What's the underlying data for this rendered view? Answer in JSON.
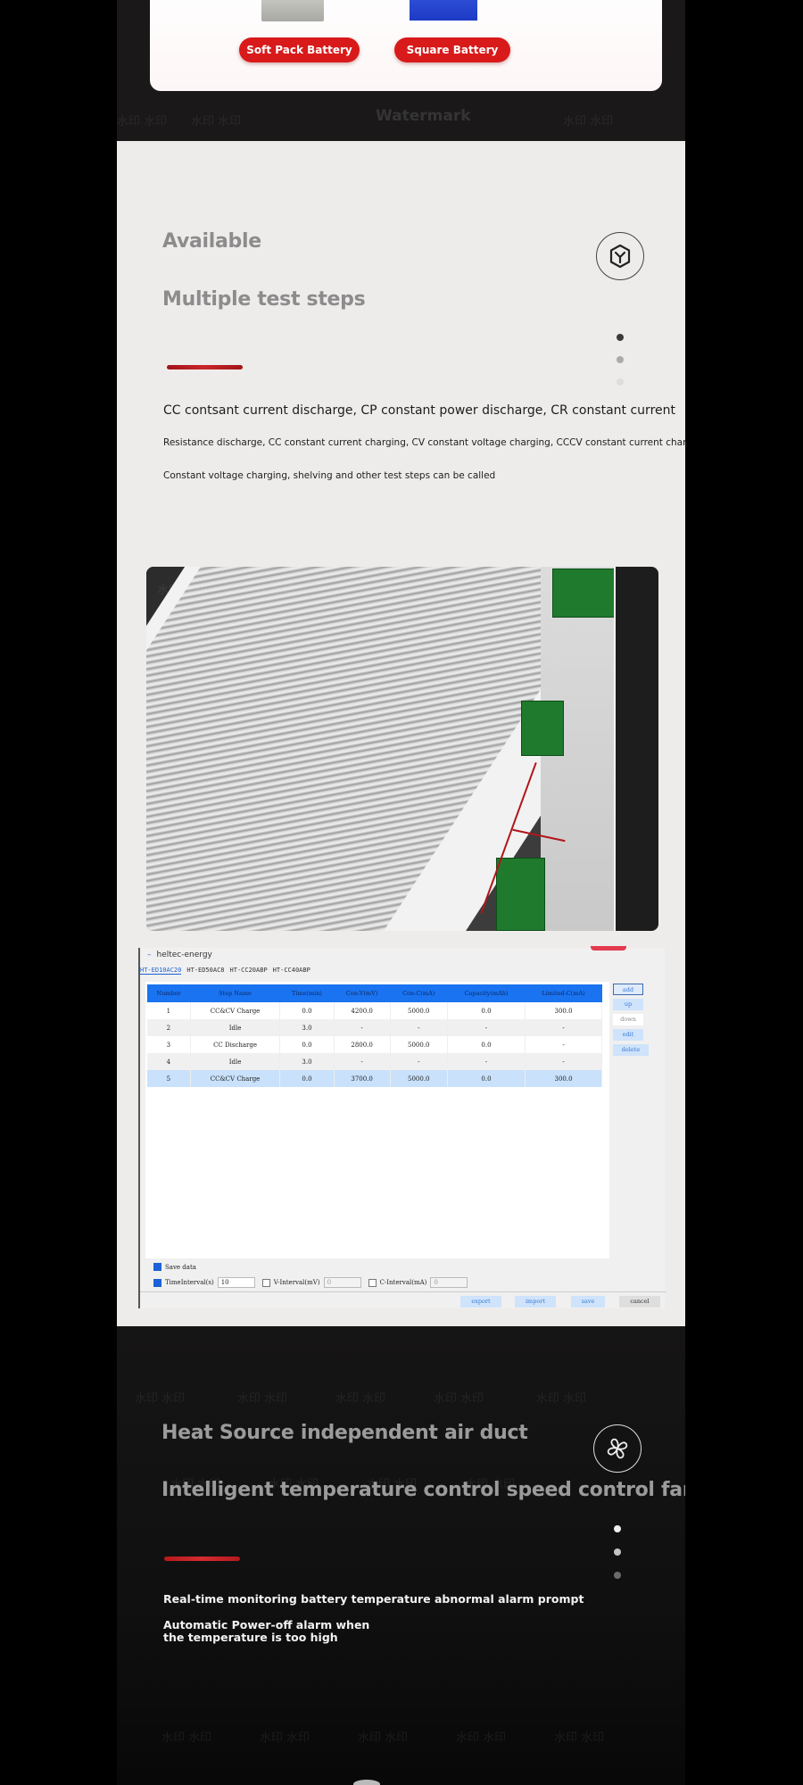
{
  "battery_card": {
    "buttons": [
      {
        "label": "Soft Pack Battery"
      },
      {
        "label": "Square Battery"
      }
    ],
    "watermark_label": "Watermark",
    "watermark_repeat": "水印 水印"
  },
  "test_steps_section": {
    "heading_line1": "Available",
    "heading_line2": "Multiple test steps",
    "icon": "cube-icon",
    "description_lines": [
      "CC contsant current discharge, CP constant power discharge, CR constant current",
      "Resistance discharge, CC constant current charging, CV constant voltage charging, CCCV constant current charging",
      "Constant voltage charging, shelving and other test steps can be called"
    ],
    "pagination": {
      "total": 3,
      "active": 1
    }
  },
  "software_window": {
    "title": "heltec-energy",
    "tabs": [
      {
        "label": "HT-ED10AC20",
        "active": true
      },
      {
        "label": "HT-ED50AC8",
        "active": false
      },
      {
        "label": "HT-CC20ABP",
        "active": false
      },
      {
        "label": "HT-CC40ABP",
        "active": false
      }
    ],
    "table": {
      "columns": [
        "Number",
        "Step Name",
        "Time(min)",
        "Con-V(mV)",
        "Con-C(mA)",
        "Capacity(mAh)",
        "Limited-C(mA)"
      ],
      "rows": [
        [
          "1",
          "CC&CV Charge",
          "0.0",
          "4200.0",
          "5000.0",
          "0.0",
          "300.0"
        ],
        [
          "2",
          "Idle",
          "3.0",
          "-",
          "-",
          "-",
          "-"
        ],
        [
          "3",
          "CC Discharge",
          "0.0",
          "2800.0",
          "5000.0",
          "0.0",
          "-"
        ],
        [
          "4",
          "Idle",
          "3.0",
          "-",
          "-",
          "-",
          "-"
        ],
        [
          "5",
          "CC&CV Charge",
          "0.0",
          "3700.0",
          "5000.0",
          "0.0",
          "300.0"
        ]
      ],
      "selected_row": 5
    },
    "side_buttons": [
      "add",
      "up",
      "down",
      "edit",
      "delete"
    ],
    "options": {
      "save_data_label": "Save data",
      "save_data_checked": true,
      "time_interval_label": "TimeInterval(s)",
      "time_interval_checked": true,
      "time_interval_value": "10",
      "v_interval_label": "V-Interval(mV)",
      "v_interval_checked": false,
      "v_interval_value": "0",
      "c_interval_label": "C-Interval(mA)",
      "c_interval_checked": false,
      "c_interval_value": "0"
    },
    "bottom_buttons": [
      "export",
      "import",
      "save",
      "cancel"
    ]
  },
  "fan_section": {
    "heading_line1": "Heat Source independent air duct",
    "heading_line2": "Intelligent temperature control speed control fan",
    "icon": "fan-icon",
    "bullets": [
      "Real-time monitoring battery temperature abnormal alarm prompt",
      "Automatic Power-off alarm when the temperature is too high"
    ],
    "pagination": {
      "total": 3,
      "active": 1
    }
  }
}
